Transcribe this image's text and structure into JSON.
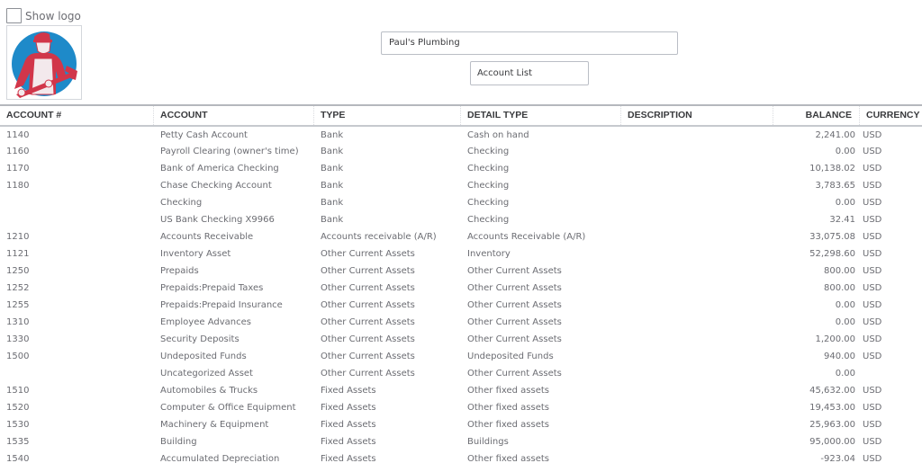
{
  "header": {
    "show_logo_label": "Show logo",
    "show_logo_checked": false,
    "logo_icon": "plumber-logo-icon",
    "company_name": "Paul's Plumbing",
    "report_title": "Account List"
  },
  "table": {
    "columns": [
      "ACCOUNT #",
      "ACCOUNT",
      "TYPE",
      "DETAIL TYPE",
      "DESCRIPTION",
      "BALANCE",
      "CURRENCY"
    ],
    "rows": [
      {
        "number": "1140",
        "account": "Petty Cash Account",
        "type": "Bank",
        "detail_type": "Cash on hand",
        "description": "",
        "balance": "2,241.00",
        "currency": "USD"
      },
      {
        "number": "1160",
        "account": "Payroll Clearing (owner's time)",
        "type": "Bank",
        "detail_type": "Checking",
        "description": "",
        "balance": "0.00",
        "currency": "USD"
      },
      {
        "number": "1170",
        "account": "Bank of America Checking",
        "type": "Bank",
        "detail_type": "Checking",
        "description": "",
        "balance": "10,138.02",
        "currency": "USD"
      },
      {
        "number": "1180",
        "account": "Chase Checking Account",
        "type": "Bank",
        "detail_type": "Checking",
        "description": "",
        "balance": "3,783.65",
        "currency": "USD"
      },
      {
        "number": "",
        "account": "Checking",
        "type": "Bank",
        "detail_type": "Checking",
        "description": "",
        "balance": "0.00",
        "currency": "USD"
      },
      {
        "number": "",
        "account": "US Bank Checking X9966",
        "type": "Bank",
        "detail_type": "Checking",
        "description": "",
        "balance": "32.41",
        "currency": "USD"
      },
      {
        "number": "1210",
        "account": "Accounts Receivable",
        "type": "Accounts receivable (A/R)",
        "detail_type": "Accounts Receivable (A/R)",
        "description": "",
        "balance": "33,075.08",
        "currency": "USD"
      },
      {
        "number": "1121",
        "account": "Inventory Asset",
        "type": "Other Current Assets",
        "detail_type": "Inventory",
        "description": "",
        "balance": "52,298.60",
        "currency": "USD"
      },
      {
        "number": "1250",
        "account": "Prepaids",
        "type": "Other Current Assets",
        "detail_type": "Other Current Assets",
        "description": "",
        "balance": "800.00",
        "currency": "USD"
      },
      {
        "number": "1252",
        "account": "Prepaids:Prepaid Taxes",
        "type": "Other Current Assets",
        "detail_type": "Other Current Assets",
        "description": "",
        "balance": "800.00",
        "currency": "USD"
      },
      {
        "number": "1255",
        "account": "Prepaids:Prepaid Insurance",
        "type": "Other Current Assets",
        "detail_type": "Other Current Assets",
        "description": "",
        "balance": "0.00",
        "currency": "USD"
      },
      {
        "number": "1310",
        "account": "Employee Advances",
        "type": "Other Current Assets",
        "detail_type": "Other Current Assets",
        "description": "",
        "balance": "0.00",
        "currency": "USD"
      },
      {
        "number": "1330",
        "account": "Security Deposits",
        "type": "Other Current Assets",
        "detail_type": "Other Current Assets",
        "description": "",
        "balance": "1,200.00",
        "currency": "USD"
      },
      {
        "number": "1500",
        "account": "Undeposited Funds",
        "type": "Other Current Assets",
        "detail_type": "Undeposited Funds",
        "description": "",
        "balance": "940.00",
        "currency": "USD"
      },
      {
        "number": "",
        "account": "Uncategorized Asset",
        "type": "Other Current Assets",
        "detail_type": "Other Current Assets",
        "description": "",
        "balance": "0.00",
        "currency": ""
      },
      {
        "number": "1510",
        "account": "Automobiles & Trucks",
        "type": "Fixed Assets",
        "detail_type": "Other fixed assets",
        "description": "",
        "balance": "45,632.00",
        "currency": "USD"
      },
      {
        "number": "1520",
        "account": "Computer & Office Equipment",
        "type": "Fixed Assets",
        "detail_type": "Other fixed assets",
        "description": "",
        "balance": "19,453.00",
        "currency": "USD"
      },
      {
        "number": "1530",
        "account": "Machinery & Equipment",
        "type": "Fixed Assets",
        "detail_type": "Other fixed assets",
        "description": "",
        "balance": "25,963.00",
        "currency": "USD"
      },
      {
        "number": "1535",
        "account": "Building",
        "type": "Fixed Assets",
        "detail_type": "Buildings",
        "description": "",
        "balance": "95,000.00",
        "currency": "USD"
      },
      {
        "number": "1540",
        "account": "Accumulated Depreciation",
        "type": "Fixed Assets",
        "detail_type": "Other fixed assets",
        "description": "",
        "balance": "-923.04",
        "currency": "USD"
      }
    ]
  },
  "colors": {
    "logo_blue": "#1e8ac9",
    "logo_red": "#d1364a",
    "text": "#6b6c72",
    "header_text": "#393a3d"
  }
}
